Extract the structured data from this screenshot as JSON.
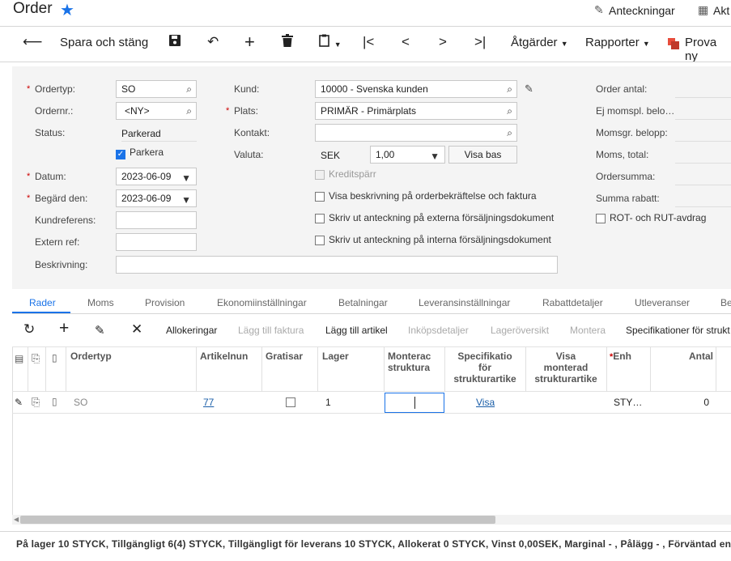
{
  "header": {
    "title": "Order",
    "notes_label": "Anteckningar",
    "activities_label": "Akt"
  },
  "toolbar": {
    "save_close_label": "Spara och stäng",
    "actions_label": "Åtgärder",
    "reports_label": "Rapporter",
    "try_new_label": "Prova ny"
  },
  "form": {
    "order_type_label": "Ordertyp:",
    "order_type_value": "SO",
    "order_nbr_label": "Ordernr.:",
    "order_nbr_value": "<NY>",
    "status_label": "Status:",
    "status_value": "Parkerad",
    "hold_label": "Parkera",
    "date_label": "Datum:",
    "date_value": "2023-06-09",
    "requested_label": "Begärd den:",
    "requested_value": "2023-06-09",
    "cust_ref_label": "Kundreferens:",
    "ext_ref_label": "Extern ref:",
    "description_label": "Beskrivning:",
    "customer_label": "Kund:",
    "customer_value": "10000 - Svenska kunden",
    "location_label": "Plats:",
    "location_value": "PRIMÄR - Primärplats",
    "contact_label": "Kontakt:",
    "currency_label": "Valuta:",
    "currency_value": "SEK",
    "rate_value": "1,00",
    "view_base_label": "Visa bas",
    "credit_hold_label": "Kreditspärr",
    "cb1_label": "Visa beskrivning på orderbekräftelse och faktura",
    "cb2_label": "Skriv ut anteckning på externa försäljningsdokument",
    "cb3_label": "Skriv ut anteckning på interna försäljningsdokument",
    "order_qty_label": "Order antal:",
    "vat_exempt_label": "Ej momspl. belo…",
    "vat_taxable_label": "Momsgr. belopp:",
    "vat_total_label": "Moms, total:",
    "order_total_label": "Ordersumma:",
    "discount_total_label": "Summa rabatt:",
    "rot_rut_label": "ROT- och RUT-avdrag"
  },
  "tabs": [
    "Rader",
    "Moms",
    "Provision",
    "Ekonomiinställningar",
    "Betalningar",
    "Leveransinställningar",
    "Rabattdetaljer",
    "Utleveranser",
    "Be"
  ],
  "grid_toolbar": {
    "allocations": "Allokeringar",
    "add_invoice": "Lägg till faktura",
    "add_item": "Lägg till artikel",
    "purchase_details": "Inköpsdetaljer",
    "inventory_summary": "Lageröversikt",
    "assemble": "Montera",
    "specifications": "Specifikationer för strukt"
  },
  "grid": {
    "columns": {
      "ordertype": "Ordertyp",
      "article_nbr": "Artikelnun",
      "free": "Gratisar",
      "warehouse": "Lager",
      "assembled_1": "Monterac",
      "assembled_2": "struktura",
      "spec_1": "Specifikatio",
      "spec_2": "för",
      "spec_3": "strukturartike",
      "show_1": "Visa",
      "show_2": "monterad",
      "show_3": "strukturartike",
      "uom": "Enh",
      "qty": "Antal"
    },
    "row": {
      "ordertype": "SO",
      "article_nbr": "77",
      "warehouse": "1",
      "spec_link": "Visa",
      "uom": "STY…",
      "qty": "0"
    }
  },
  "footer": {
    "text": "På lager 10 STYCK, Tillgängligt 6(4) STYCK, Tillgängligt för leverans 10 STYCK, Allokerat 0 STYCK, Vinst 0,00SEK, Marginal - , Pålägg - , Förväntad enhetsk"
  }
}
